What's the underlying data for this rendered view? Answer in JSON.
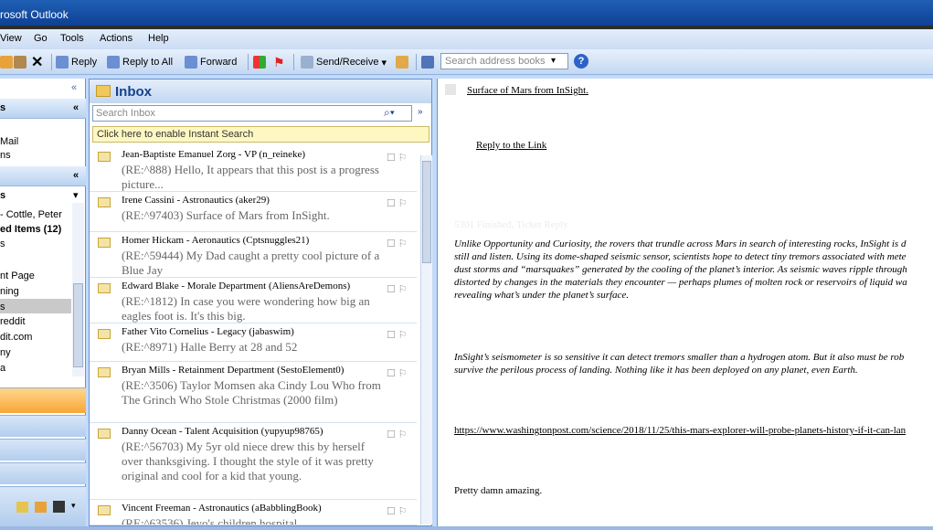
{
  "app_title": "rosoft Outlook",
  "menu": [
    "View",
    "Go",
    "Tools",
    "Actions",
    "Help"
  ],
  "toolbar": {
    "reply": "Reply",
    "reply_all": "Reply to All",
    "forward": "Forward",
    "send_receive": "Send/Receive",
    "search_placeholder": "Search address books"
  },
  "nav": {
    "items": [
      "s",
      "Mail",
      "ns",
      "s",
      "- Cottle, Peter",
      "ed Items (12)",
      "s",
      "nt Page",
      "ning",
      "s",
      "reddit",
      "dit.com",
      "ny",
      "a"
    ]
  },
  "inbox": {
    "title": "Inbox",
    "search_placeholder": "Search Inbox",
    "instant_search": "Click here to enable Instant Search",
    "messages": [
      {
        "sender": "Jean-Baptiste Emanuel Zorg - VP (n_reineke)",
        "preview": "(RE:^888) Hello, It appears that this post is a progress picture..."
      },
      {
        "sender": "Irene Cassini - Astronautics (aker29)",
        "preview": "(RE:^97403) Surface of Mars from InSight."
      },
      {
        "sender": "Homer Hickam - Aeronautics (Cptsnuggles21)",
        "preview": "(RE:^59444) My Dad caught a pretty cool picture of a Blue Jay"
      },
      {
        "sender": "Edward Blake - Morale Department (AliensAreDemons)",
        "preview": "(RE:^1812) In case you were wondering how big an eagles foot is. It's this big."
      },
      {
        "sender": "Father Vito Cornelius - Legacy (jabaswim)",
        "preview": "(RE:^8971) Halle Berry at 28 and 52"
      },
      {
        "sender": "Bryan Mills - Retainment Department (SestoElement0)",
        "preview": "(RE:^3506) Taylor Momsen aka Cindy Lou Who from The Grinch Who Stole Christmas (2000 film)"
      },
      {
        "sender": "Danny Ocean - Talent Acquisition (yupyup98765)",
        "preview": "(RE:^56703) My 5yr old niece drew this by herself over thanksgiving. I thought the style of it was pretty original and cool for a kid that young."
      },
      {
        "sender": "Vincent Freeman - Astronautics (aBabblingBook)",
        "preview": "(RE:^63536) Jeyo's children hospital"
      }
    ]
  },
  "reading": {
    "link1": "Surface of Mars from InSight.",
    "link2": "Reply to the Link",
    "faded": "5301 Finished, Ticket Reply",
    "para1": "Unlike Opportunity and Curiosity, the rovers that trundle across Mars in search of interesting rocks, InSight is d\nstill and listen. Using its dome-shaped seismic sensor, scientists hope to detect tiny tremors associated with mete\ndust storms and “marsquakes” generated by the cooling of the planet’s interior. As seismic waves ripple through\ndistorted by changes in the materials they encounter — perhaps plumes of molten rock or reservoirs of liquid wa\nrevealing what’s under the planet’s surface.",
    "para2": "InSight’s seismometer is so sensitive it can detect tremors smaller than a hydrogen atom. But it also must be rob\nsurvive the perilous process of landing. Nothing like it has been deployed on any planet, even Earth.",
    "url": "https://www.washingtonpost.com/science/2018/11/25/this-mars-explorer-will-probe-planets-history-if-it-can-lan",
    "closing": "Pretty damn amazing."
  }
}
